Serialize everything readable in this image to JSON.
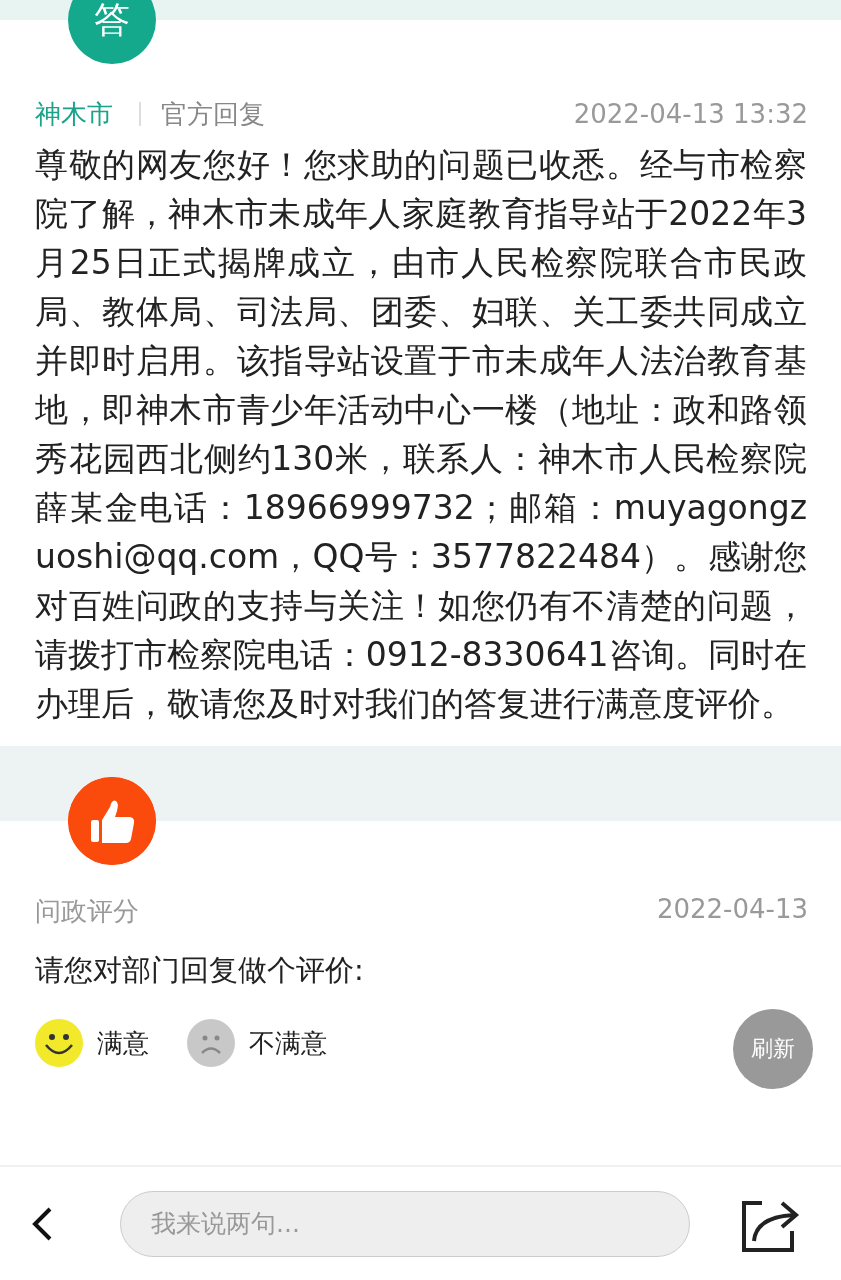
{
  "answer": {
    "avatar_label": "答",
    "department": "神木市",
    "reply_type": "官方回复",
    "time": "2022-04-13 13:32",
    "body": "尊敬的网友您好！您求助的问题已收悉。经与市检察院了解，神木市未成年人家庭教育指导站于2022年3月25日正式揭牌成立，由市人民检察院联合市民政局、教体局、司法局、团委、妇联、关工委共同成立并即时启用。该指导站设置于市未成年人法治教育基地，即神木市青少年活动中心一楼（地址：政和路领秀花园西北侧约130米，联系人：神木市人民检察院薛某金电话：18966999732；邮箱：muyagongzuoshi@qq.com，QQ号：3577822484）。感谢您对百姓问政的支持与关注！如您仍有不清楚的问题，请拨打市检察院电话：0912-8330641咨询。同时在办理后，敬请您及时对我们的答复进行满意度评价。"
  },
  "rating": {
    "title": "问政评分",
    "date": "2022-04-13",
    "prompt": "请您对部门回复做个评价:",
    "options": [
      {
        "kind": "satisfied",
        "label": "满意"
      },
      {
        "kind": "unsatisfied",
        "label": "不满意"
      }
    ],
    "refresh_button": "刷新"
  },
  "bottom_bar": {
    "comment_placeholder": "我来说两句..."
  }
}
